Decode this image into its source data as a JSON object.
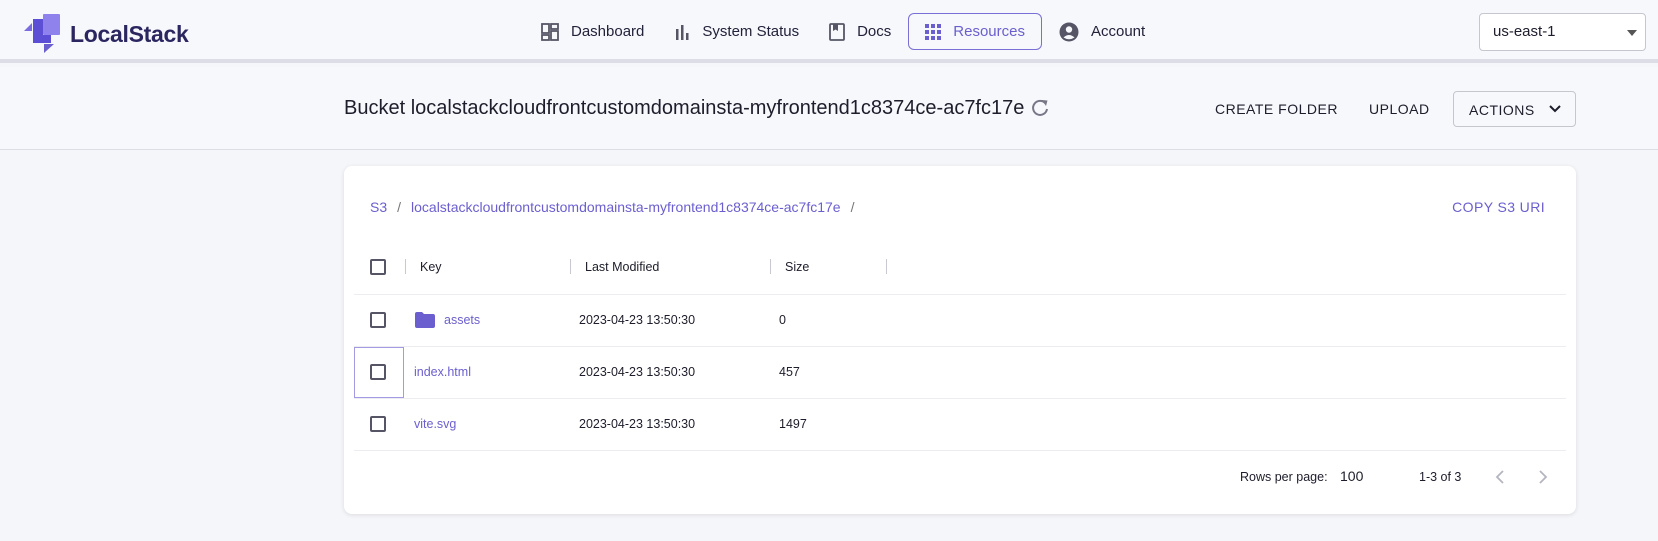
{
  "brand": {
    "name": "LocalStack"
  },
  "nav": {
    "items": [
      {
        "label": "Dashboard",
        "icon": "dashboard-icon"
      },
      {
        "label": "System Status",
        "icon": "bar-chart-icon"
      },
      {
        "label": "Docs",
        "icon": "book-icon"
      },
      {
        "label": "Resources",
        "icon": "grid-icon",
        "active": true
      },
      {
        "label": "Account",
        "icon": "account-circle-icon"
      }
    ],
    "region": "us-east-1"
  },
  "header": {
    "title": "Bucket localstackcloudfrontcustomdomainsta-myfrontend1c8374ce-ac7fc17e",
    "create_folder": "CREATE FOLDER",
    "upload": "UPLOAD",
    "actions": "ACTIONS"
  },
  "breadcrumb": {
    "root": "S3",
    "bucket": "localstackcloudfrontcustomdomainsta-myfrontend1c8374ce-ac7fc17e",
    "separator": "/"
  },
  "copy_uri": "COPY S3 URI",
  "table": {
    "columns": [
      "Key",
      "Last Modified",
      "Size"
    ],
    "rows": [
      {
        "key": "assets",
        "type": "folder",
        "modified": "2023-04-23 13:50:30",
        "size": "0"
      },
      {
        "key": "index.html",
        "type": "file",
        "modified": "2023-04-23 13:50:30",
        "size": "457"
      },
      {
        "key": "vite.svg",
        "type": "file",
        "modified": "2023-04-23 13:50:30",
        "size": "1497"
      }
    ]
  },
  "pagination": {
    "rows_per_page_label": "Rows per page:",
    "rows_per_page": "100",
    "range": "1-3 of 3"
  },
  "colors": {
    "accent": "#6b5fcf",
    "brand_dark": "#2c2660"
  }
}
